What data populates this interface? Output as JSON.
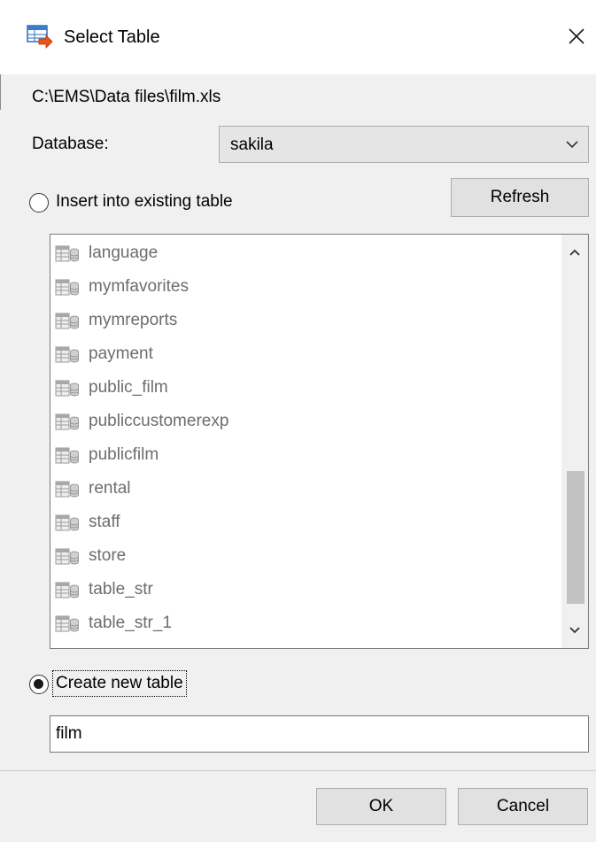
{
  "window": {
    "title": "Select Table",
    "icon": "select-table-icon",
    "close_icon": "close-icon"
  },
  "source": {
    "path": "C:\\EMS\\Data files\\film.xls"
  },
  "database": {
    "label": "Database:",
    "value": "sakila"
  },
  "insert_option": {
    "label": "Insert into existing table",
    "selected": false
  },
  "refresh_label": "Refresh",
  "table_list": {
    "items": [
      "language",
      "mymfavorites",
      "mymreports",
      "payment",
      "public_film",
      "publiccustomerexp",
      "publicfilm",
      "rental",
      "staff",
      "store",
      "table_str",
      "table_str_1"
    ],
    "item_icon": "table-icon"
  },
  "create_option": {
    "label": "Create new table",
    "selected": true
  },
  "new_table_name": {
    "value": "film"
  },
  "buttons": {
    "ok": "OK",
    "cancel": "Cancel"
  },
  "colors": {
    "window_background": "#f0f0f0",
    "disabled_text": "#6d6d6d",
    "button_face": "#e1e1e1",
    "border": "#adadad"
  }
}
